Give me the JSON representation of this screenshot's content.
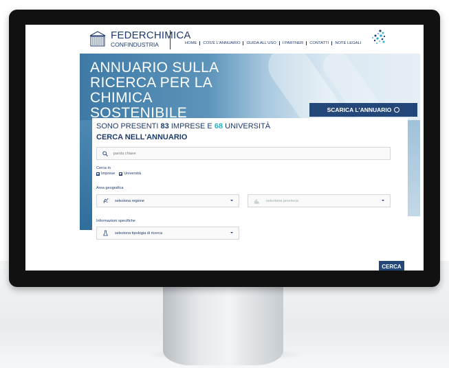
{
  "header": {
    "brand_name": "FEDERCHIMICA",
    "brand_sub": "CONFINDUSTRIA",
    "nav": [
      "HOME",
      "COS'È L'ANNUARIO",
      "GUIDA ALL'USO",
      "I PARTNER",
      "CONTATTI",
      "NOTE LEGALI"
    ]
  },
  "hero": {
    "title_line1": "ANNUARIO SULLA",
    "title_line2": "RICERCA PER LA",
    "title_line3": "CHIMICA SOSTENIBILE",
    "download_label": "SCARICA L'ANNUARIO"
  },
  "search": {
    "count_prefix": "SONO PRESENTI",
    "count_companies": "83",
    "count_middle": "IMPRESE E",
    "count_universities": "68",
    "count_suffix": "UNIVERSITÀ",
    "title": "CERCA NELL'ANNUARIO",
    "keyword_placeholder": "parola chiave",
    "search_in_label": "Cerca in",
    "option_companies": "Imprese",
    "option_universities": "Università",
    "area_label": "Area geografica",
    "region_placeholder": "seleziona regione",
    "province_placeholder": "seleziona provincia",
    "info_label": "Informazioni specifiche",
    "type_placeholder": "seleziona tipologia di ricerca",
    "submit_label": "CERCA"
  },
  "colors": {
    "brand_navy": "#1d3a6b",
    "button_navy": "#234778",
    "accent_teal": "#27b3c6"
  },
  "icons": [
    "building-logo-icon",
    "search-icon",
    "check-icon",
    "map-pin-icon",
    "province-icon",
    "flask-icon",
    "download-circle-icon",
    "caret-down-icon"
  ]
}
